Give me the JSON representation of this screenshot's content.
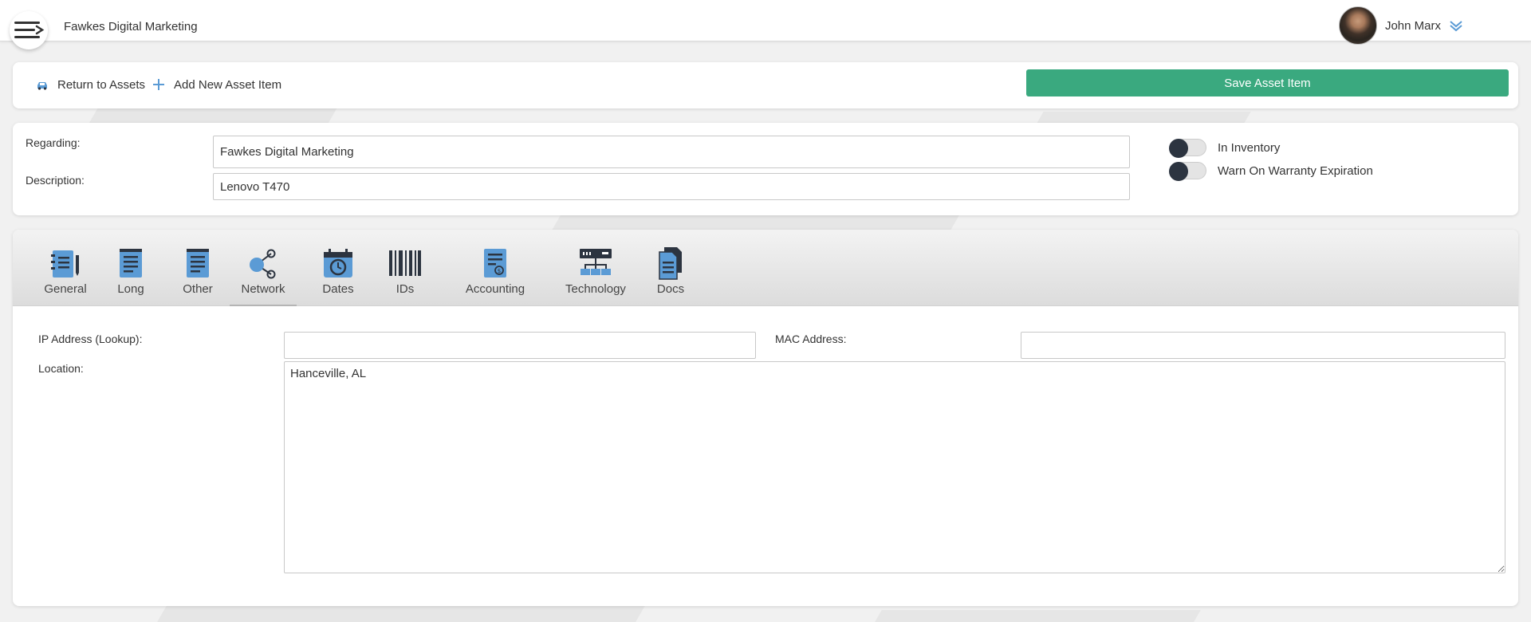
{
  "header": {
    "company": "Fawkes Digital Marketing",
    "user_name": "John Marx",
    "menu_icon": "hamburger-menu-icon",
    "dropdown_icon": "chevron-down-icon"
  },
  "actions": {
    "return_label": "Return to Assets",
    "add_label": "Add New Asset Item",
    "save_label": "Save Asset Item"
  },
  "form": {
    "regarding_label": "Regarding:",
    "regarding_value": "Fawkes Digital Marketing",
    "description_label": "Description:",
    "description_value": "Lenovo T470",
    "toggles": [
      {
        "label": "In Inventory",
        "on": false
      },
      {
        "label": "Warn On Warranty Expiration",
        "on": false
      }
    ]
  },
  "tabs": [
    {
      "label": "General",
      "icon": "notebook-pen-icon"
    },
    {
      "label": "Long",
      "icon": "notepad-icon"
    },
    {
      "label": "Other",
      "icon": "notepad-icon"
    },
    {
      "label": "Network",
      "icon": "share-network-icon",
      "active": true
    },
    {
      "label": "Dates",
      "icon": "calendar-clock-icon"
    },
    {
      "label": "IDs",
      "icon": "barcode-icon"
    },
    {
      "label": "Accounting",
      "icon": "invoice-icon"
    },
    {
      "label": "Technology",
      "icon": "server-network-icon"
    },
    {
      "label": "Docs",
      "icon": "documents-icon"
    }
  ],
  "network": {
    "ip_label": "IP Address (Lookup):",
    "ip_value": "",
    "mac_label": "MAC Address:",
    "mac_value": "",
    "location_label": "Location:",
    "location_value": "Hanceville, AL"
  },
  "colors": {
    "save_button": "#3aa97f",
    "icon_blue": "#5b9bd5",
    "icon_dark": "#2c3440",
    "toggle_knob": "#2c3440"
  }
}
